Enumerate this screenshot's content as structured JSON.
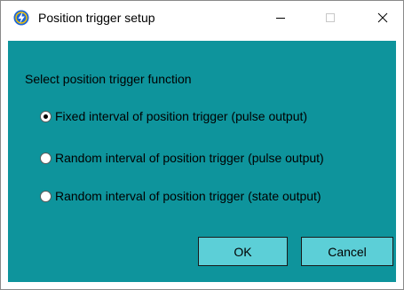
{
  "window": {
    "title": "Position trigger setup",
    "minimize_label": "—",
    "maximize_label": "☐",
    "close_label": "✕"
  },
  "dialog": {
    "prompt": "Select position trigger function",
    "options": [
      {
        "label": "Fixed interval of position trigger (pulse output)",
        "selected": true
      },
      {
        "label": "Random interval of position trigger (pulse output)",
        "selected": false
      },
      {
        "label": "Random interval of position trigger (state output)",
        "selected": false
      }
    ],
    "ok_label": "OK",
    "cancel_label": "Cancel"
  },
  "colors": {
    "client_background": "#0e949c",
    "button_background": "#5ccfd7",
    "app_icon_blue": "#1f66d6",
    "app_icon_yellow": "#f5c400"
  },
  "icons": {
    "app": "lightning-bolt-app-icon",
    "minimize": "minimize-icon",
    "maximize": "maximize-icon",
    "close": "close-icon"
  }
}
